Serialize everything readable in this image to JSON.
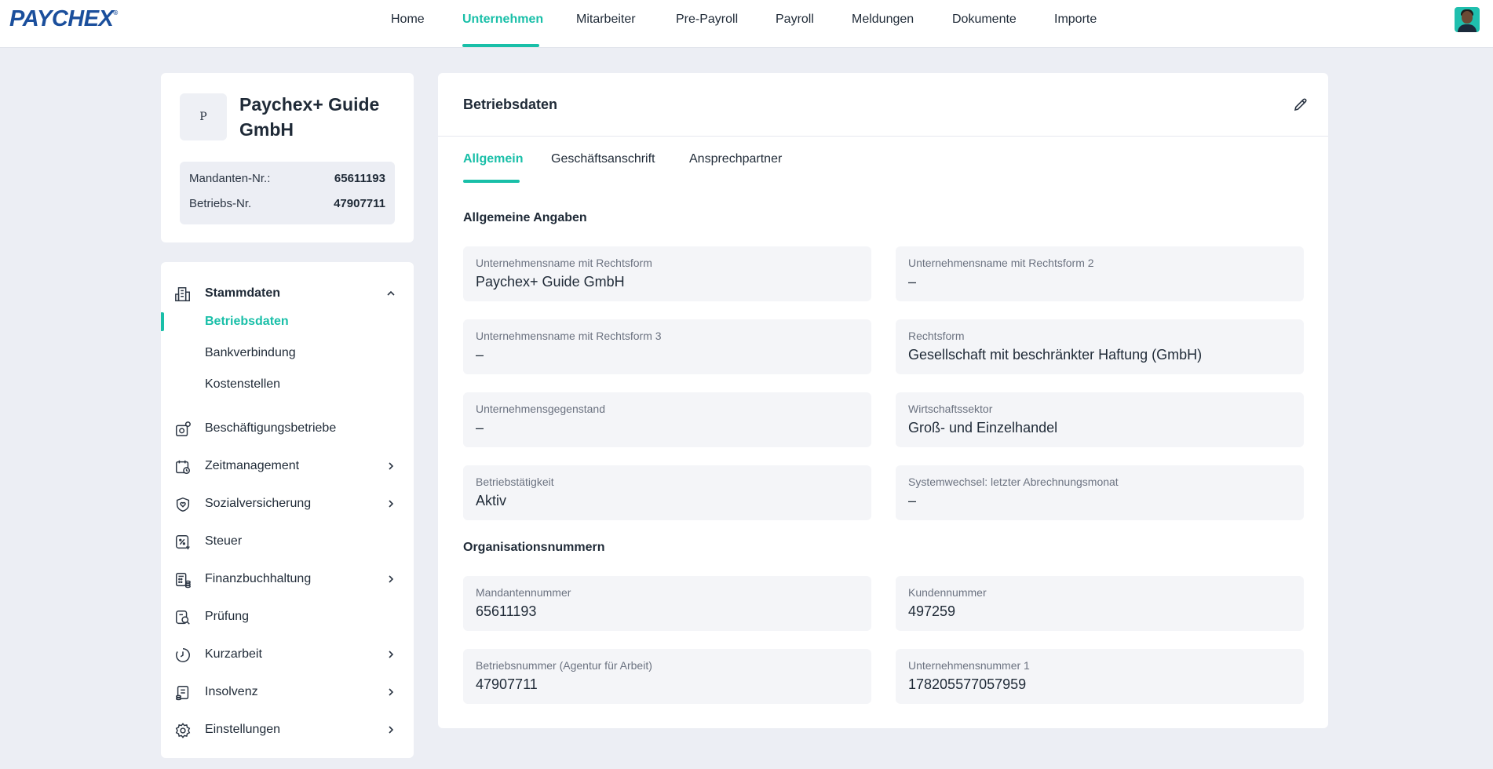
{
  "brand": {
    "logo_text": "PAYCHEX",
    "logo_mark": "®",
    "accent": "#19bfa8",
    "logo_color": "#1b4f9c"
  },
  "nav": {
    "items": [
      {
        "label": "Home",
        "active": false
      },
      {
        "label": "Unternehmen",
        "active": true
      },
      {
        "label": "Mitarbeiter",
        "active": false
      },
      {
        "label": "Pre-Payroll",
        "active": false
      },
      {
        "label": "Payroll",
        "active": false
      },
      {
        "label": "Meldungen",
        "active": false
      },
      {
        "label": "Dokumente",
        "active": false
      },
      {
        "label": "Importe",
        "active": false
      }
    ],
    "avatar_icon": "user-avatar"
  },
  "company": {
    "badge": "P",
    "name": "Paychex+ Guide GmbH",
    "ids": [
      {
        "label": "Mandanten-Nr.:",
        "value": "65611193"
      },
      {
        "label": "Betriebs-Nr.",
        "value": "47907711"
      }
    ]
  },
  "sidebar": {
    "stammdaten": {
      "label": "Stammdaten",
      "icon": "building-icon",
      "expanded": true,
      "subitems": [
        {
          "label": "Betriebsdaten",
          "active": true
        },
        {
          "label": "Bankverbindung",
          "active": false
        },
        {
          "label": "Kostenstellen",
          "active": false
        }
      ]
    },
    "items": [
      {
        "label": "Beschäftigungsbetriebe",
        "icon": "business-location-icon",
        "has_chevron": false
      },
      {
        "label": "Zeitmanagement",
        "icon": "calendar-clock-icon",
        "has_chevron": true
      },
      {
        "label": "Sozialversicherung",
        "icon": "shield-heart-icon",
        "has_chevron": true
      },
      {
        "label": "Steuer",
        "icon": "tax-percent-icon",
        "has_chevron": false
      },
      {
        "label": "Finanzbuchhaltung",
        "icon": "calculator-coins-icon",
        "has_chevron": true
      },
      {
        "label": "Prüfung",
        "icon": "document-search-icon",
        "has_chevron": false
      },
      {
        "label": "Kurzarbeit",
        "icon": "clock-icon",
        "has_chevron": true
      },
      {
        "label": "Insolvenz",
        "icon": "document-coins-icon",
        "has_chevron": true
      },
      {
        "label": "Einstellungen",
        "icon": "gear-icon",
        "has_chevron": true
      }
    ]
  },
  "main": {
    "title": "Betriebsdaten",
    "edit_icon": "pencil-icon",
    "tabs": [
      {
        "label": "Allgemein",
        "active": true
      },
      {
        "label": "Geschäftsanschrift",
        "active": false
      },
      {
        "label": "Ansprechpartner",
        "active": false
      }
    ],
    "sections": [
      {
        "title": "Allgemeine Angaben",
        "fields": [
          {
            "label": "Unternehmensname mit Rechtsform",
            "value": "Paychex+ Guide GmbH"
          },
          {
            "label": "Unternehmensname mit Rechtsform 2",
            "value": "–"
          },
          {
            "label": "Unternehmensname mit Rechtsform 3",
            "value": "–"
          },
          {
            "label": "Rechtsform",
            "value": "Gesellschaft mit beschränkter Haftung (GmbH)"
          },
          {
            "label": "Unternehmensgegenstand",
            "value": "–"
          },
          {
            "label": "Wirtschaftssektor",
            "value": "Groß- und Einzelhandel"
          },
          {
            "label": "Betriebstätigkeit",
            "value": "Aktiv"
          },
          {
            "label": "Systemwechsel: letzter Abrechnungsmonat",
            "value": "–"
          }
        ]
      },
      {
        "title": "Organisationsnummern",
        "fields": [
          {
            "label": "Mandantennummer",
            "value": "65611193"
          },
          {
            "label": "Kundennummer",
            "value": "497259"
          },
          {
            "label": "Betriebsnummer (Agentur für Arbeit)",
            "value": "47907711"
          },
          {
            "label": "Unternehmensnummer 1",
            "value": "178205577057959"
          }
        ]
      }
    ]
  }
}
